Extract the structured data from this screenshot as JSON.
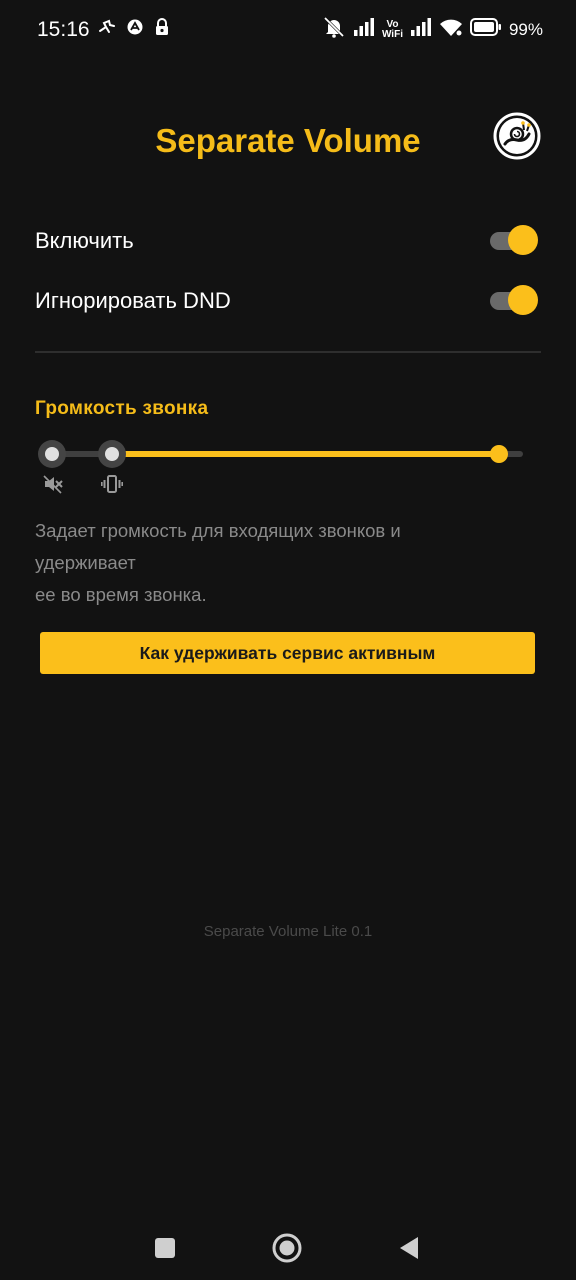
{
  "status_bar": {
    "time": "15:16",
    "vowifi_top": "Vo",
    "vowifi_bottom": "WiFi",
    "battery_percent": "99%",
    "left_icons": [
      "running-app-icon",
      "autoresponder-icon",
      "vpn-lock-icon"
    ],
    "right_icons": [
      "silent-bell-icon",
      "signal-icon",
      "vowifi-icon",
      "signal-icon",
      "wifi-icon",
      "battery-icon"
    ]
  },
  "header": {
    "title": "Separate Volume",
    "logo_icon": "snail-logo-icon"
  },
  "settings": [
    {
      "label": "Включить",
      "enabled": true
    },
    {
      "label": "Игнорировать DND",
      "enabled": true
    }
  ],
  "ringer": {
    "section_title": "Громкость звонка",
    "slider_value_fraction": 0.95,
    "stops": [
      "mute-icon",
      "vibrate-icon"
    ],
    "description_lines": [
      "Задает громкость для входящих звонков и",
      "удерживает",
      "ее во время звонка."
    ]
  },
  "action_button_label": "Как удерживать сервис активным",
  "footer_version": "Separate Volume Lite 0.1",
  "navbar": [
    "recents-square-icon",
    "home-circle-icon",
    "back-triangle-icon"
  ],
  "colors": {
    "accent": "#FBBF1B",
    "background": "#121212",
    "muted_text": "#8a8a8a"
  }
}
